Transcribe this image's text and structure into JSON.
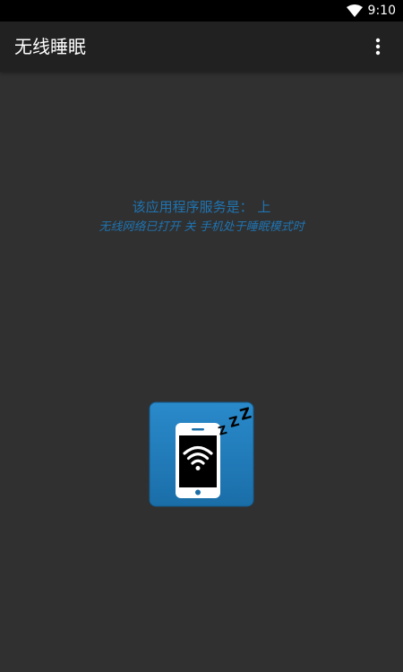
{
  "status_bar": {
    "time": "9:10",
    "icons": [
      "wifi-icon"
    ]
  },
  "app_bar": {
    "title": "无线睡眠",
    "overflow_icon": "more-vert-icon"
  },
  "main": {
    "service_status_label": "该应用程序服务是：",
    "service_status_value": "上",
    "description": "无线网络已打开 关 手机处于睡眠模式时",
    "toggle_icon": "phone-wifi-sleep-icon",
    "sleep_text": "Z Z Z"
  },
  "colors": {
    "background": "#303030",
    "app_bar": "#212121",
    "status_bar": "#000000",
    "accent_text": "#1f74b2",
    "icon_tile": "#1f7ab8"
  }
}
